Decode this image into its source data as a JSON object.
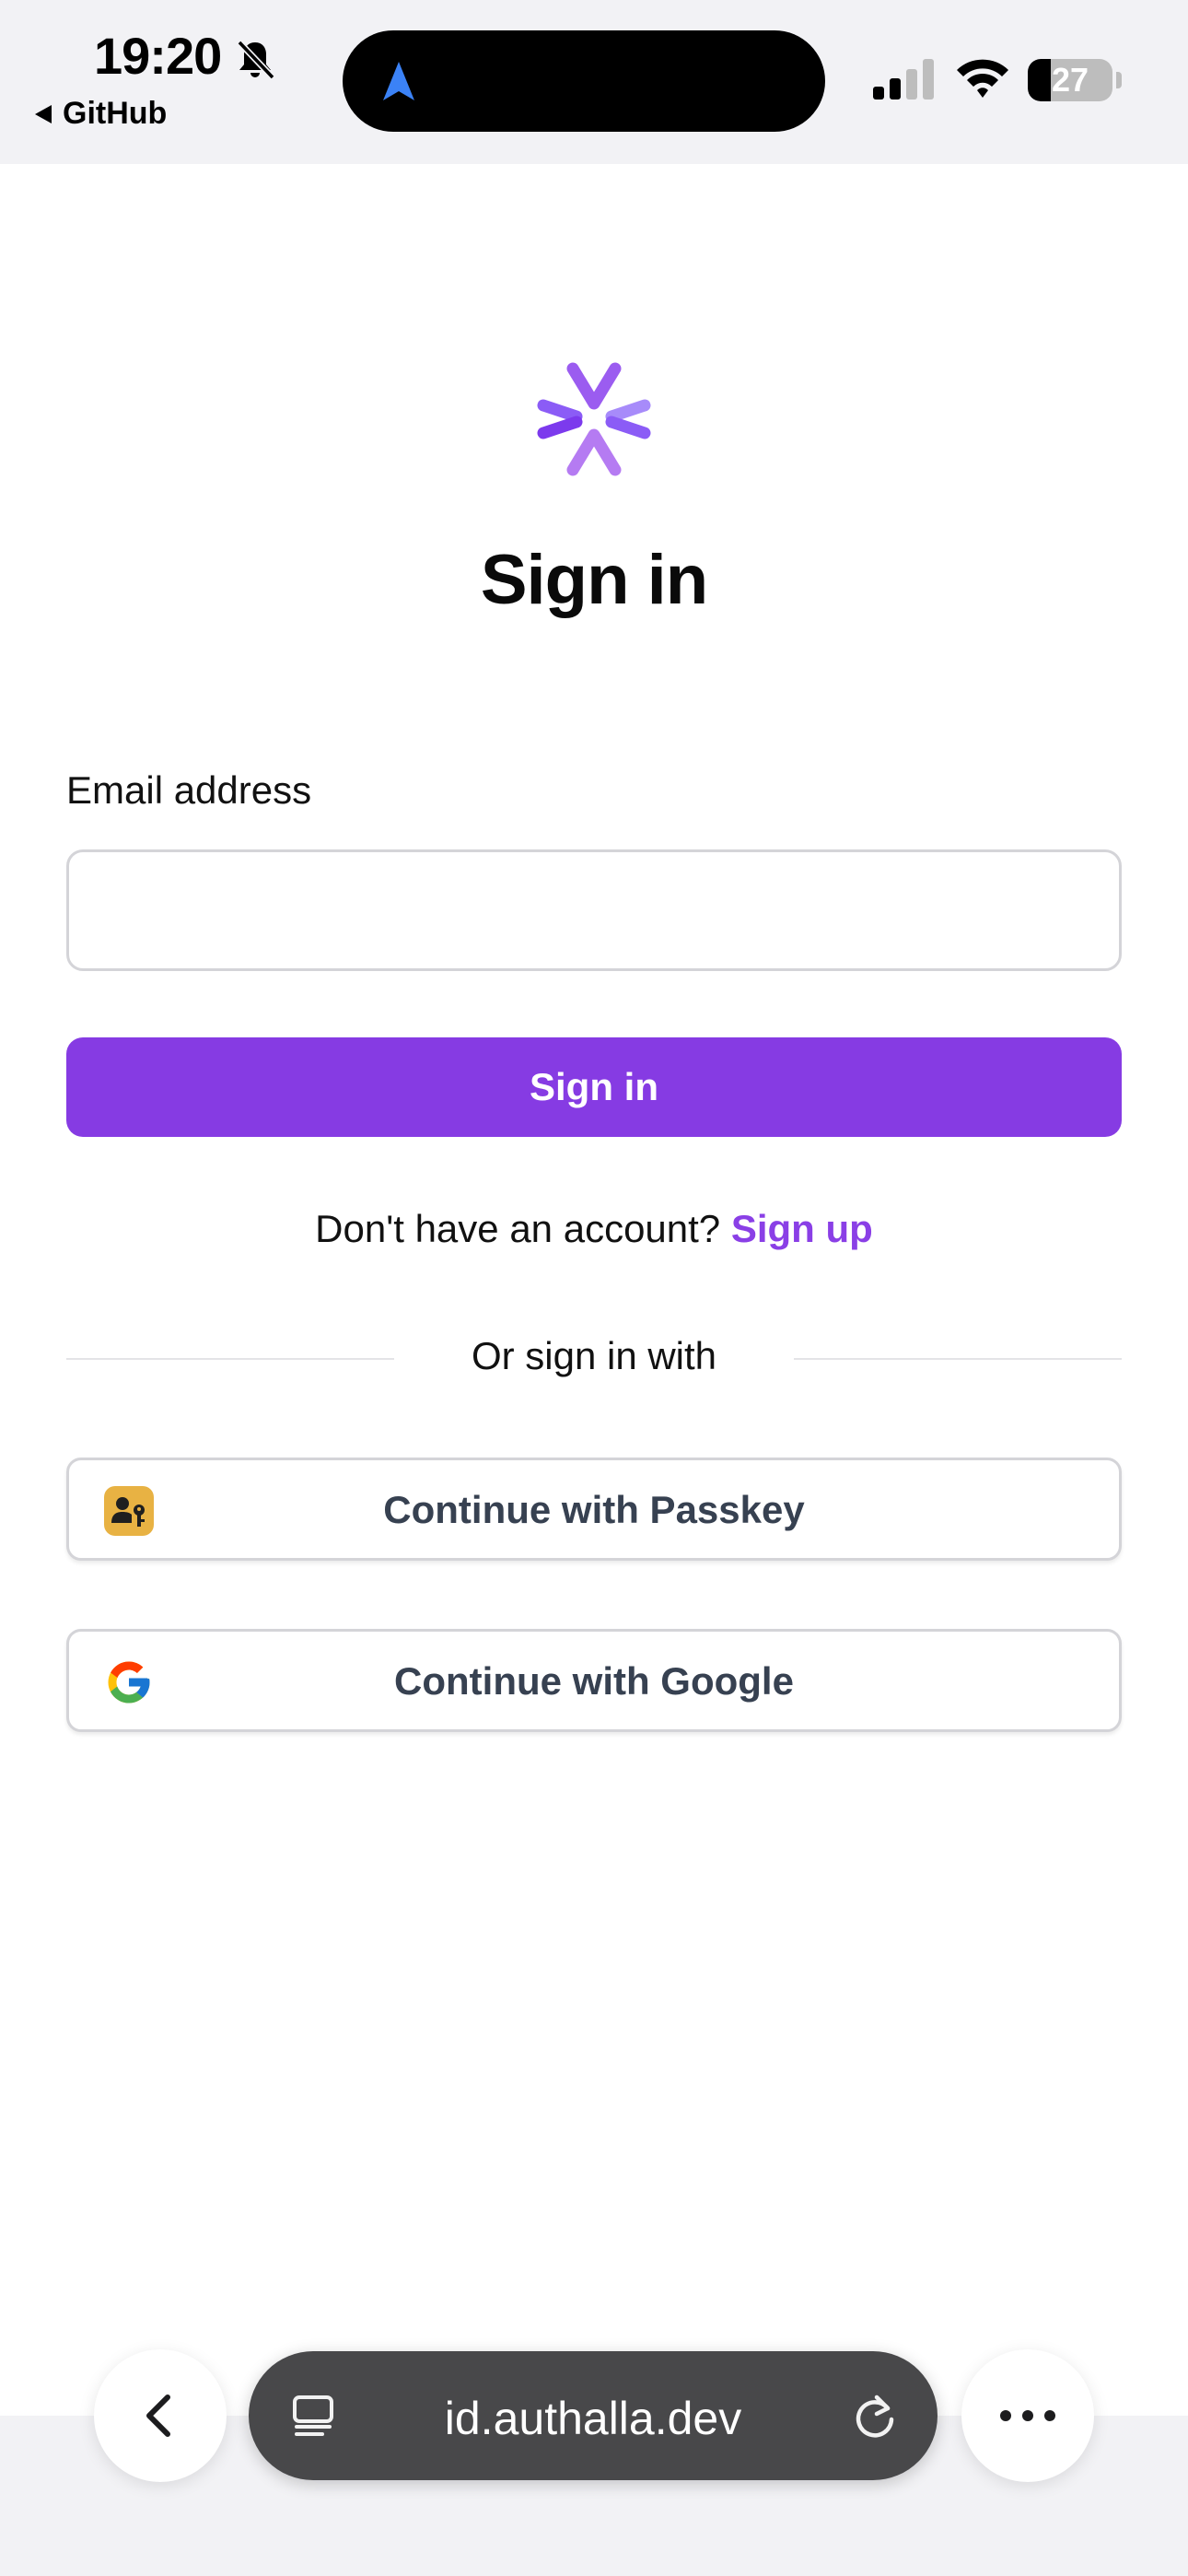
{
  "status_bar": {
    "time": "19:20",
    "back_app": "GitHub",
    "battery": "27",
    "battery_level_percent": 27,
    "icons": [
      "bell-slash-icon",
      "navigation-arrow-icon",
      "cellular-signal-icon",
      "wifi-icon",
      "battery-icon"
    ]
  },
  "page": {
    "logo": "authalla-logo",
    "title": "Sign in"
  },
  "form": {
    "email_label": "Email address",
    "email_value": "",
    "email_placeholder": "",
    "submit_label": "Sign in"
  },
  "signup": {
    "prompt": "Don't have an account?",
    "link_label": "Sign up"
  },
  "divider": {
    "text": "Or sign in with"
  },
  "social": {
    "passkey_label": "Continue with Passkey",
    "google_label": "Continue with Google"
  },
  "browser": {
    "url": "id.authalla.dev",
    "icons": [
      "chevron-left-icon",
      "tabs-icon",
      "reload-icon",
      "more-icon"
    ]
  },
  "colors": {
    "accent": "#863be3",
    "link": "#8a3fe6",
    "logo_primary": "#8b5cf6",
    "logo_secondary": "#c084fc",
    "passkey_icon": "#e8b243"
  }
}
